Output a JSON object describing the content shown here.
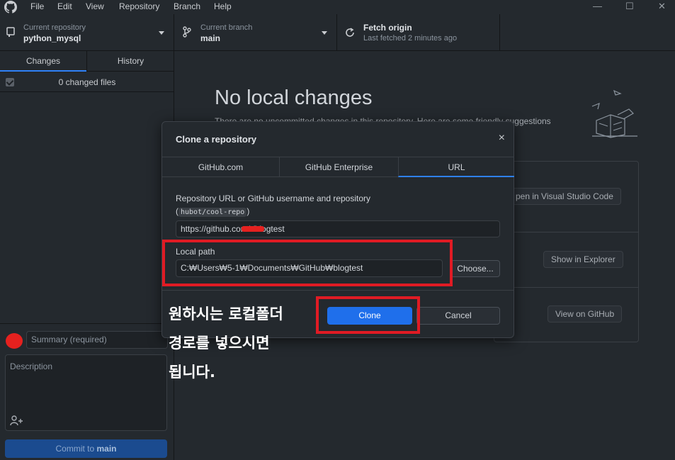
{
  "menu": [
    "File",
    "Edit",
    "View",
    "Repository",
    "Branch",
    "Help"
  ],
  "window_controls": {
    "minimize": "—",
    "maximize": "☐",
    "close": "✕"
  },
  "toolbar": {
    "repo": {
      "small": "Current repository",
      "big": "python_mysql"
    },
    "branch": {
      "small": "Current branch",
      "big": "main"
    },
    "fetch": {
      "big": "Fetch origin",
      "small": "Last fetched 2 minutes ago"
    }
  },
  "sidebar": {
    "tabs": [
      "Changes",
      "History"
    ],
    "changed_files": "0 changed files",
    "summary_placeholder": "Summary (required)",
    "description_placeholder": "Description",
    "commit_prefix": "Commit to ",
    "commit_branch": "main"
  },
  "main": {
    "title": "No local changes",
    "subtitle": "There are no uncommitted changes in this repository. Here are some friendly suggestions",
    "suggestions": [
      "pen in Visual Studio Code",
      "Show in Explorer",
      "View on GitHub"
    ]
  },
  "modal": {
    "title": "Clone a repository",
    "close": "×",
    "tabs": [
      "GitHub.com",
      "GitHub Enterprise",
      "URL"
    ],
    "active_tab": "URL",
    "url_label": "Repository URL or GitHub username and repository",
    "url_hint_open": "(",
    "url_hint_code": "hubot/cool-repo",
    "url_hint_close": ")",
    "url_value": "https://github.com/          /blogtest",
    "local_label": "Local path",
    "local_value": "C:₩Users₩5-1₩Documents₩GitHub₩blogtest",
    "choose_label": "Choose...",
    "clone_label": "Clone",
    "cancel_label": "Cancel"
  },
  "annotation": {
    "lines": [
      "원하시는 로컬폴더",
      "경로를 넣으시면",
      "됩니다."
    ],
    "color": "#e01b24"
  },
  "colors": {
    "accent": "#1f6feb",
    "background": "#24292e",
    "annotation": "#e01b24"
  }
}
